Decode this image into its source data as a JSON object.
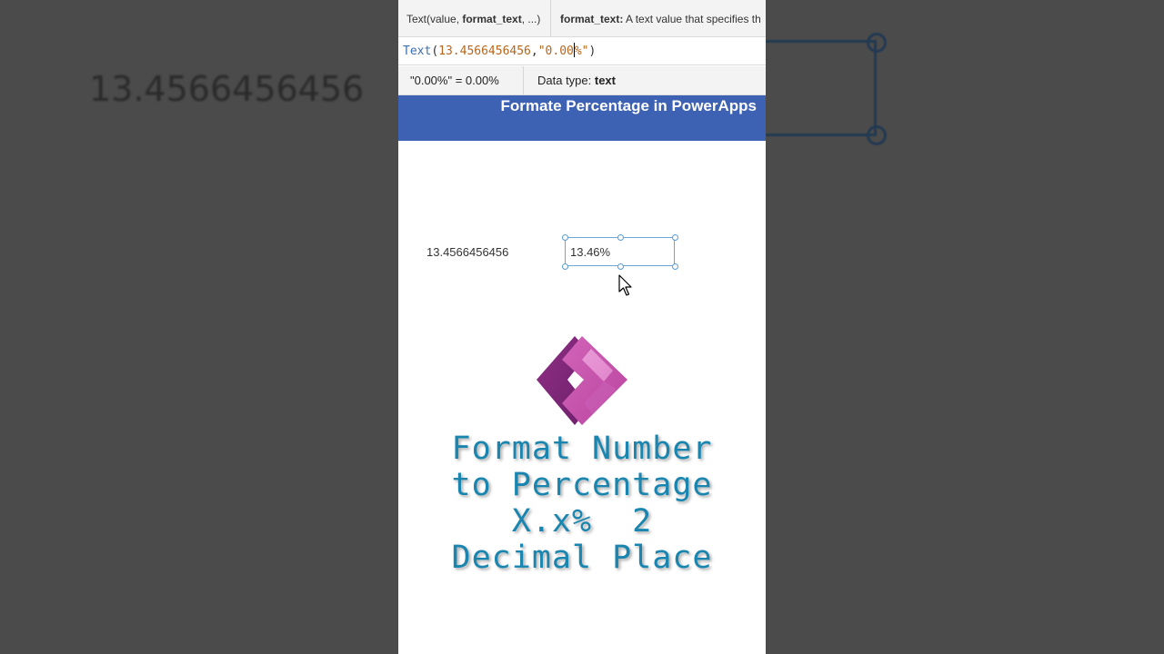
{
  "background": {
    "blurred_number": "13.4566456456"
  },
  "intellisense": {
    "signature_prefix": "Text(value, ",
    "signature_bold": "format_text",
    "signature_suffix": ", ...)",
    "description_bold": "format_text:",
    "description_text": " A text value that specifies th"
  },
  "formula": {
    "function": "Text",
    "open": "(",
    "number": "13.4566456456",
    "comma": ",",
    "string_before_caret": "\"0.00",
    "string_after_caret": "%\"",
    "close": ")"
  },
  "result": {
    "evaluation": "\"0.00%\"  =  0.00%",
    "data_type_label": "Data type: ",
    "data_type_value": "text"
  },
  "app_header": {
    "title": "Formate Percentage in PowerApps",
    "color": "#3d61b3"
  },
  "canvas": {
    "label_value": "13.4566456456",
    "textbox_value": "13.46%"
  },
  "caption": {
    "lines": [
      "Format Number",
      "to Percentage",
      "X.x%  2",
      "Decimal Place"
    ],
    "color": "#1a86b0"
  },
  "icons": {
    "logo": "powerapps-logo-icon",
    "cursor": "mouse-pointer-icon"
  }
}
